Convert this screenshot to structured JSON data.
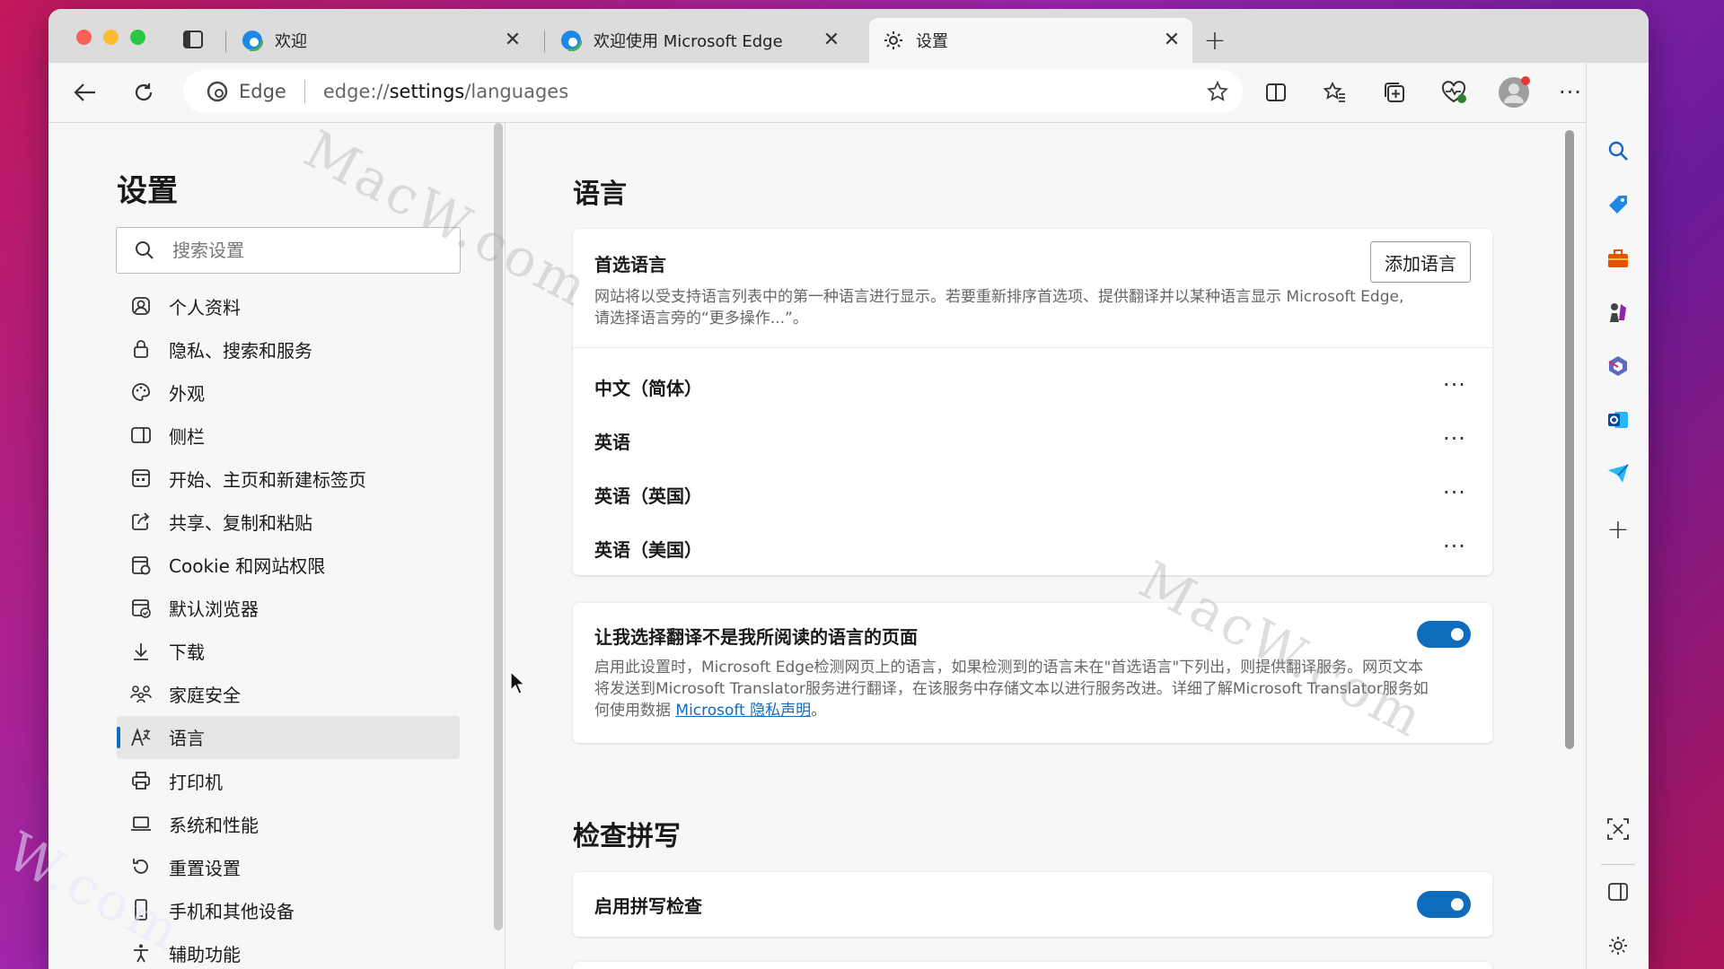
{
  "tabs": [
    {
      "title": "欢迎",
      "active": false
    },
    {
      "title": "欢迎使用 Microsoft Edge",
      "active": false
    },
    {
      "title": "设置",
      "active": true
    }
  ],
  "address_bar": {
    "site_label": "Edge",
    "url_scheme": "edge://",
    "url_host": "settings",
    "url_path": "/languages"
  },
  "nav": {
    "title": "设置",
    "search_placeholder": "搜索设置",
    "items": [
      {
        "label": "个人资料",
        "icon": "profile-icon"
      },
      {
        "label": "隐私、搜索和服务",
        "icon": "lock-icon"
      },
      {
        "label": "外观",
        "icon": "palette-icon"
      },
      {
        "label": "侧栏",
        "icon": "sidebar-icon"
      },
      {
        "label": "开始、主页和新建标签页",
        "icon": "home-icon"
      },
      {
        "label": "共享、复制和粘贴",
        "icon": "share-icon"
      },
      {
        "label": "Cookie 和网站权限",
        "icon": "cookie-icon"
      },
      {
        "label": "默认浏览器",
        "icon": "browser-icon"
      },
      {
        "label": "下载",
        "icon": "download-icon"
      },
      {
        "label": "家庭安全",
        "icon": "family-icon"
      },
      {
        "label": "语言",
        "icon": "language-icon",
        "selected": true
      },
      {
        "label": "打印机",
        "icon": "printer-icon"
      },
      {
        "label": "系统和性能",
        "icon": "laptop-icon"
      },
      {
        "label": "重置设置",
        "icon": "reset-icon"
      },
      {
        "label": "手机和其他设备",
        "icon": "phone-icon"
      },
      {
        "label": "辅助功能",
        "icon": "accessibility-icon"
      }
    ]
  },
  "languages_section": {
    "title": "语言",
    "preferred": {
      "heading": "首选语言",
      "add_button": "添加语言",
      "description_line1": "网站将以受支持语言列表中的第一种语言进行显示。若要重新排序首选项、提供翻译并以某种语言显示 Microsoft Edge,",
      "description_line2": "请选择语言旁的“更多操作...”。",
      "languages": [
        "中文（简体）",
        "英语",
        "英语（英国）",
        "英语（美国）"
      ],
      "more_label": "···"
    },
    "translate": {
      "heading": "让我选择翻译不是我所阅读的语言的页面",
      "enabled": true,
      "description_line1": "启用此设置时，Microsoft Edge检测网页上的语言，如果检测到的语言未在\"首选语言\"下列出，则提供翻译服务。网页文本",
      "description_line2": "将发送到Microsoft Translator服务进行翻译，在该服务中存储文本以进行服务改进。详细了解Microsoft Translator服务如",
      "description_line3_prefix": "何使用数据 ",
      "link_text": "Microsoft 隐私声明",
      "description_line3_suffix": "。"
    }
  },
  "spellcheck_section": {
    "title": "检查拼写",
    "enable_label": "启用拼写检查",
    "enabled": true
  },
  "watermarks": [
    "MacW.com",
    "MacW.com",
    "W.com"
  ],
  "colors": {
    "accent": "#0f6cbd",
    "traffic_red": "#fe5f57",
    "traffic_yellow": "#febc2e",
    "traffic_green": "#28c840"
  }
}
